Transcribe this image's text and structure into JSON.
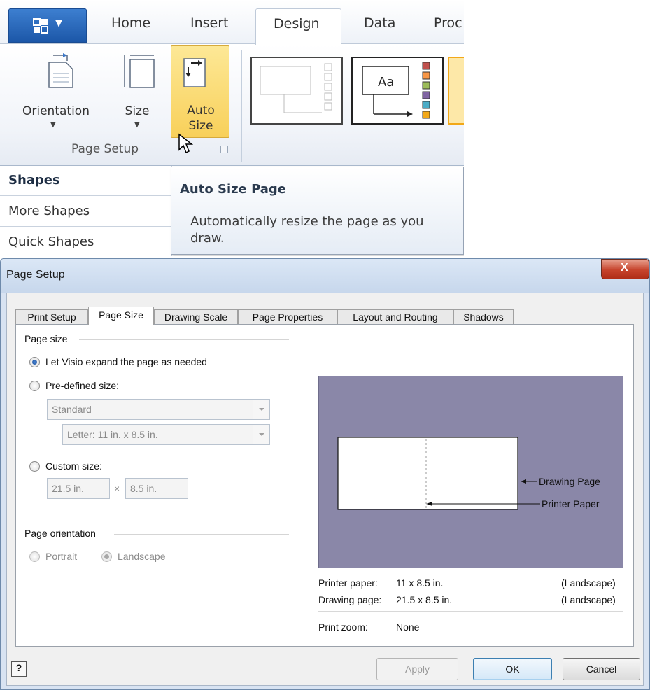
{
  "ribbon": {
    "tabs": [
      "Home",
      "Insert",
      "Design",
      "Data",
      "Proc"
    ],
    "active_tab": "Design",
    "file_menu_icon": "visio-app-icon",
    "buttons": {
      "orientation": "Orientation",
      "size": "Size",
      "auto_size_line1": "Auto",
      "auto_size_line2": "Size"
    },
    "group_label": "Page Setup"
  },
  "theme_gallery": {
    "thumb2_text": "Aa",
    "swatch_colors": [
      "#c0504d",
      "#f79646",
      "#9bbb59",
      "#8064a2",
      "#4bacc6",
      "#f2a818"
    ]
  },
  "shapes_pane": {
    "title": "Shapes",
    "items": [
      "More Shapes",
      "Quick Shapes"
    ]
  },
  "tooltip": {
    "title": "Auto Size Page",
    "body": "Automatically resize the page as you draw."
  },
  "dialog": {
    "title": "Page Setup",
    "close_label": "X",
    "tabs": [
      "Print Setup",
      "Page Size",
      "Drawing Scale",
      "Page Properties",
      "Layout and Routing",
      "Shadows"
    ],
    "active_tab": "Page Size",
    "page_size": {
      "section_label": "Page size",
      "options": {
        "expand": "Let Visio expand the page as needed",
        "predefined": "Pre-defined size:",
        "custom": "Custom size:"
      },
      "selected_option": "expand",
      "predefined_category": "Standard",
      "predefined_size": "Letter:  11 in. x 8.5 in.",
      "custom_width": "21.5 in.",
      "custom_x": "×",
      "custom_height": "8.5 in."
    },
    "orientation": {
      "section_label": "Page orientation",
      "portrait": "Portrait",
      "landscape": "Landscape",
      "selected": "landscape"
    },
    "preview": {
      "background_color": "#8a87a8",
      "drawing_page_label": "Drawing Page",
      "printer_paper_label": "Printer Paper"
    },
    "info": {
      "printer_paper_label": "Printer paper:",
      "printer_paper_value": "11 x 8.5 in.",
      "printer_paper_orientation": "(Landscape)",
      "drawing_page_label": "Drawing page:",
      "drawing_page_value": "21.5 x 8.5 in.",
      "drawing_page_orientation": "(Landscape)",
      "print_zoom_label": "Print zoom:",
      "print_zoom_value": "None"
    },
    "help_label": "?",
    "buttons": {
      "apply": "Apply",
      "ok": "OK",
      "cancel": "Cancel"
    }
  }
}
